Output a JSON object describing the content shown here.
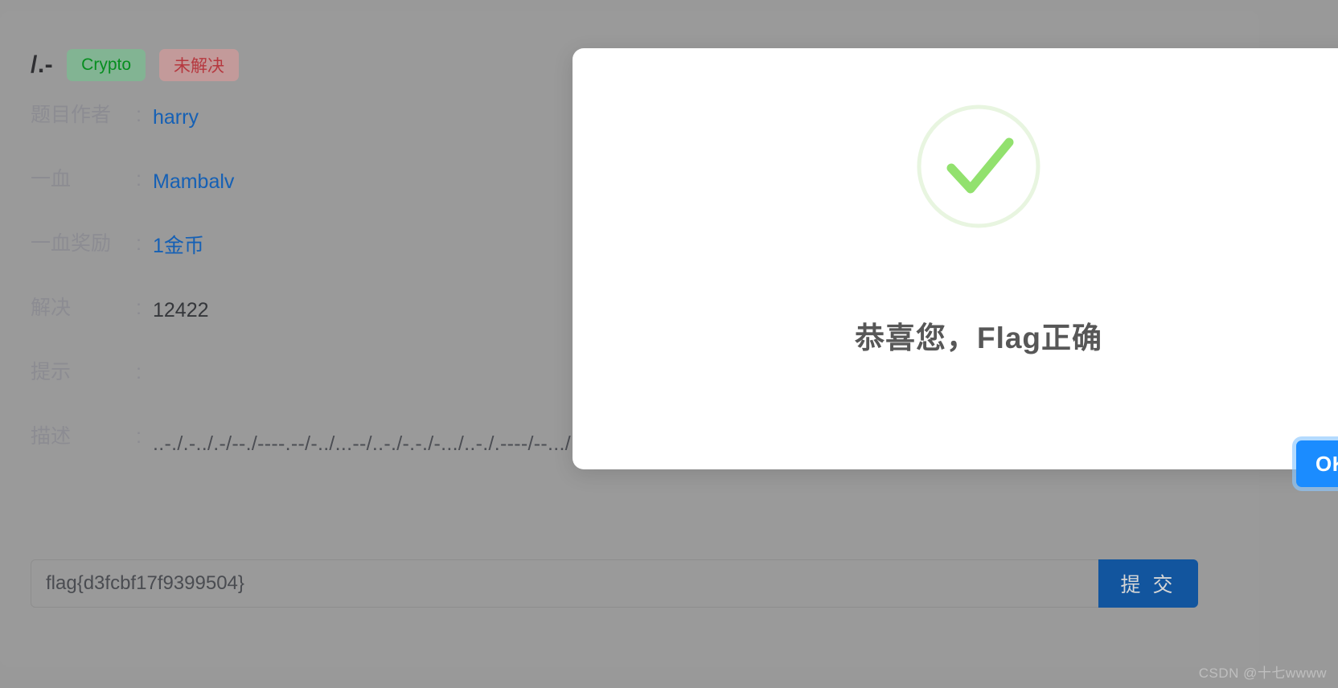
{
  "challenge": {
    "title": "/.-",
    "category_tag": "Crypto",
    "status_tag": "未解决",
    "meta": [
      {
        "label": "题目作者",
        "value": "harry",
        "style": "link"
      },
      {
        "label": "一血",
        "value": "Mambalv",
        "style": "link"
      },
      {
        "label": "一血奖励",
        "value": "1金币",
        "style": "link"
      },
      {
        "label": "解决",
        "value": "12422",
        "style": "plain"
      },
      {
        "label": "提示",
        "value": "",
        "style": "plain"
      },
      {
        "label": "描述",
        "value": "..-./.-../.-/--./----.--/-../...--/..-./-.-./-.../..-./.----/--.../..-./----./...--/----./----./...../-----/....-/-----.-",
        "style": "morse"
      }
    ]
  },
  "flag_form": {
    "input_value": "flag{d3fcbf17f9399504}",
    "input_placeholder": "flag{}",
    "submit_label": "提 交"
  },
  "modal": {
    "icon": "success-check-icon",
    "message": "恭喜您，Flag正确",
    "ok_label": "OK",
    "check_color": "#92e16e",
    "ring_color": "#e8f5e0"
  },
  "watermark": "CSDN @十七wwww"
}
